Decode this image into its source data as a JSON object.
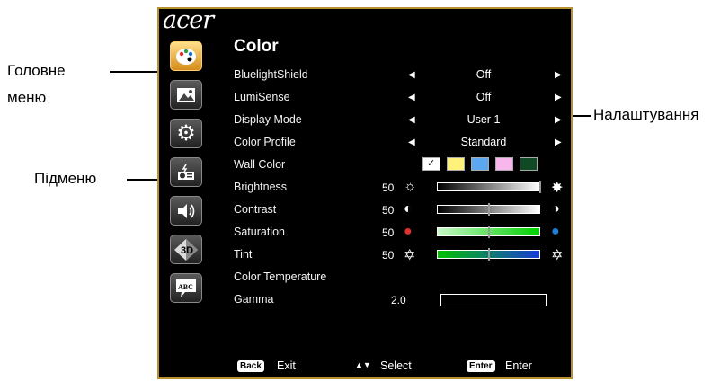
{
  "annotations": {
    "main_menu": "Головне меню",
    "submenu": "Підменю",
    "settings": "Налаштування"
  },
  "osd": {
    "brand": "acer",
    "sidebar_icons": [
      "palette-icon",
      "image-icon",
      "gear-icon",
      "projector-icon",
      "speaker-icon",
      "3d-icon",
      "abc-icon"
    ],
    "title": "Color",
    "rows": [
      {
        "label": "BluelightShield",
        "value": "Off"
      },
      {
        "label": "LumiSense",
        "value": "Off"
      },
      {
        "label": "Display Mode",
        "value": "User 1"
      },
      {
        "label": "Color Profile",
        "value": "Standard"
      }
    ],
    "wall_color_label": "Wall Color",
    "wall_colors": [
      "#ffffff",
      "#fff27a",
      "#5ba8f0",
      "#f7b6ec",
      "#0f4a25"
    ],
    "sliders": [
      {
        "label": "Brightness",
        "value": "50",
        "level": 1.0
      },
      {
        "label": "Contrast",
        "value": "50",
        "level": 0.5
      },
      {
        "label": "Saturation",
        "value": "50",
        "level": 0.5
      },
      {
        "label": "Tint",
        "value": "50",
        "level": 0.5
      }
    ],
    "color_temperature_label": "Color Temperature",
    "gamma": {
      "label": "Gamma",
      "value": "2.0"
    },
    "footer": {
      "back_key": "Back",
      "back_label": "Exit",
      "select_label": "Select",
      "enter_key": "Enter",
      "enter_label": "Enter"
    }
  }
}
